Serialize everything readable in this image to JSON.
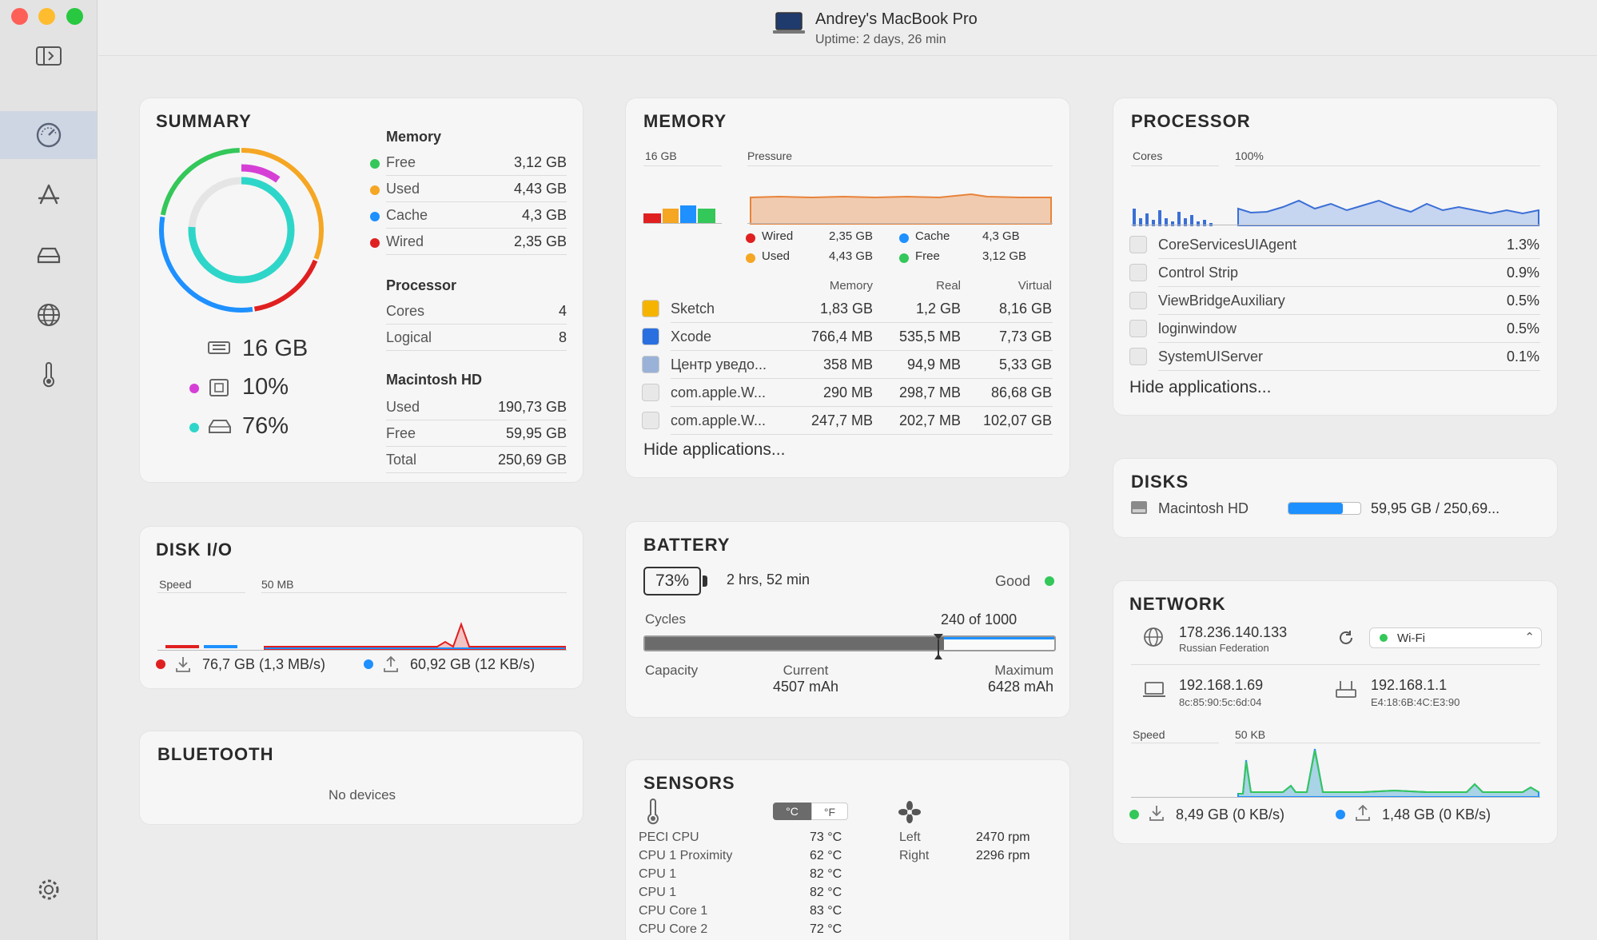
{
  "window": {
    "title": "Andrey's MacBook Pro",
    "uptime": "Uptime: 2 days, 26 min"
  },
  "sidebar": {
    "items": [
      "dashboard",
      "apps",
      "disks",
      "network",
      "sensors",
      "settings"
    ]
  },
  "summary": {
    "title": "SUMMARY",
    "memory_header": "Memory",
    "memory": [
      {
        "label": "Free",
        "value": "3,12 GB",
        "color": "#34c759"
      },
      {
        "label": "Used",
        "value": "4,43 GB",
        "color": "#f5a623"
      },
      {
        "label": "Cache",
        "value": "4,3 GB",
        "color": "#1e90ff"
      },
      {
        "label": "Wired",
        "value": "2,35 GB",
        "color": "#e02020"
      }
    ],
    "processor_header": "Processor",
    "processor": [
      {
        "label": "Cores",
        "value": "4"
      },
      {
        "label": "Logical",
        "value": "8"
      }
    ],
    "disk_header": "Macintosh HD",
    "disk": [
      {
        "label": "Used",
        "value": "190,73 GB"
      },
      {
        "label": "Free",
        "value": "59,95 GB"
      },
      {
        "label": "Total",
        "value": "250,69 GB"
      }
    ],
    "ram_total": "16 GB",
    "cpu_pct": "10%",
    "disk_pct": "76%",
    "ring_values": {
      "memory_parts_gb": [
        2.35,
        4.43,
        4.3,
        3.12
      ],
      "cpu": 0.1,
      "disk": 0.76
    }
  },
  "memory": {
    "title": "MEMORY",
    "bar_label": "16 GB",
    "pressure_label": "Pressure",
    "legend": [
      {
        "label": "Wired",
        "value": "2,35 GB",
        "color": "#e02020"
      },
      {
        "label": "Cache",
        "value": "4,3 GB",
        "color": "#1e90ff"
      },
      {
        "label": "Used",
        "value": "4,43 GB",
        "color": "#f5a623"
      },
      {
        "label": "Free",
        "value": "3,12 GB",
        "color": "#34c759"
      }
    ],
    "columns": [
      "Memory",
      "Real",
      "Virtual"
    ],
    "apps": [
      {
        "name": "Sketch",
        "memory": "1,83 GB",
        "real": "1,2 GB",
        "virtual": "8,16 GB",
        "icon": "sketch-icon"
      },
      {
        "name": "Xcode",
        "memory": "766,4 MB",
        "real": "535,5 MB",
        "virtual": "7,73 GB",
        "icon": "xcode-icon"
      },
      {
        "name": "Центр уведо...",
        "memory": "358 MB",
        "real": "94,9 MB",
        "virtual": "5,33 GB",
        "icon": "notification-center-icon"
      },
      {
        "name": "com.apple.W...",
        "memory": "290 MB",
        "real": "298,7 MB",
        "virtual": "86,68 GB",
        "icon": "shield-app-icon"
      },
      {
        "name": "com.apple.W...",
        "memory": "247,7 MB",
        "real": "202,7 MB",
        "virtual": "102,07 GB",
        "icon": "shield-app-icon"
      }
    ],
    "hide_label": "Hide applications..."
  },
  "processor": {
    "title": "PROCESSOR",
    "cores_label": "Cores",
    "pct_label": "100%",
    "apps": [
      {
        "name": "CoreServicesUIAgent",
        "value": "1.3%"
      },
      {
        "name": "Control Strip",
        "value": "0.9%"
      },
      {
        "name": "ViewBridgeAuxiliary",
        "value": "0.5%"
      },
      {
        "name": "loginwindow",
        "value": "0.5%"
      },
      {
        "name": "SystemUIServer",
        "value": "0.1%"
      }
    ],
    "hide_label": "Hide applications..."
  },
  "disks": {
    "title": "DISKS",
    "name": "Macintosh HD",
    "usage": "59,95 GB / 250,69...",
    "fill": 0.76
  },
  "diskio": {
    "title": "DISK I/O",
    "speed_label": "Speed",
    "scale_label": "50 MB",
    "read": "76,7 GB (1,3 MB/s)",
    "write": "60,92 GB (12 KB/s)"
  },
  "bluetooth": {
    "title": "BLUETOOTH",
    "empty": "No devices"
  },
  "battery": {
    "title": "BATTERY",
    "percent": "73%",
    "charge": 0.73,
    "time": "2 hrs, 52 min",
    "health": "Good",
    "cycles_label": "Cycles",
    "cycles_value": "240 of 1000",
    "cycles_fill": 0.24,
    "capacity_label": "Capacity",
    "current_label": "Current",
    "current_value": "4507 mAh",
    "max_label": "Maximum",
    "max_value": "6428 mAh",
    "current_fill": 0.73
  },
  "sensors": {
    "title": "SENSORS",
    "unit_c": "°C",
    "unit_f": "°F",
    "temps": [
      {
        "label": "PECI CPU",
        "value": "73 °C"
      },
      {
        "label": "CPU 1 Proximity",
        "value": "62 °C"
      },
      {
        "label": "CPU 1",
        "value": "82 °C"
      },
      {
        "label": "CPU 1",
        "value": "82 °C"
      },
      {
        "label": "CPU Core 1",
        "value": "83 °C"
      },
      {
        "label": "CPU Core 2",
        "value": "72 °C"
      }
    ],
    "fans": [
      {
        "label": "Left",
        "value": "2470 rpm"
      },
      {
        "label": "Right",
        "value": "2296 rpm"
      }
    ]
  },
  "network": {
    "title": "NETWORK",
    "public_ip": "178.236.140.133",
    "country": "Russian Federation",
    "interface": "Wi-Fi",
    "local_ip": "192.168.1.69",
    "local_mac": "8c:85:90:5c:6d:04",
    "router_ip": "192.168.1.1",
    "router_mac": "E4:18:6B:4C:E3:90",
    "speed_label": "Speed",
    "scale_label": "50 KB",
    "download": "8,49 GB (0 KB/s)",
    "upload": "1,48 GB (0 KB/s)"
  },
  "colors": {
    "red": "#e02020",
    "orange": "#f5a623",
    "blue": "#1e90ff",
    "green": "#34c759",
    "teal": "#2ed6c9",
    "magenta": "#d63fd6"
  }
}
